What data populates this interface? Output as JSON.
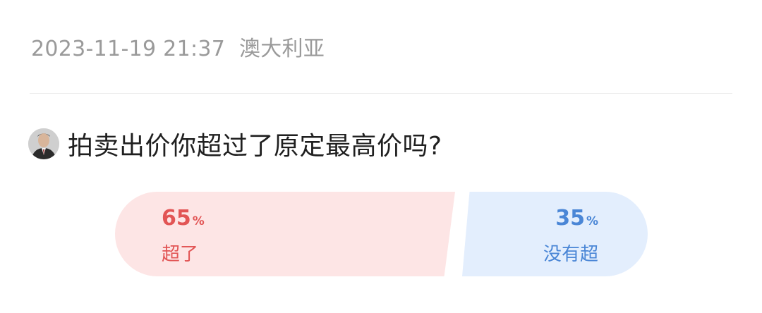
{
  "header": {
    "datetime": "2023-11-19 21:37",
    "location": "澳大利亚"
  },
  "question": {
    "text": "拍卖出价你超过了原定最高价吗?",
    "avatar_icon": "user-avatar-icon"
  },
  "poll": {
    "options": [
      {
        "percent_value": "65",
        "percent_unit": "%",
        "label": "超了",
        "share": 0.65,
        "color": "#e25555",
        "bg": "#fde5e5"
      },
      {
        "percent_value": "35",
        "percent_unit": "%",
        "label": "没有超",
        "share": 0.35,
        "color": "#4a86d6",
        "bg": "#e3eefd"
      }
    ]
  }
}
